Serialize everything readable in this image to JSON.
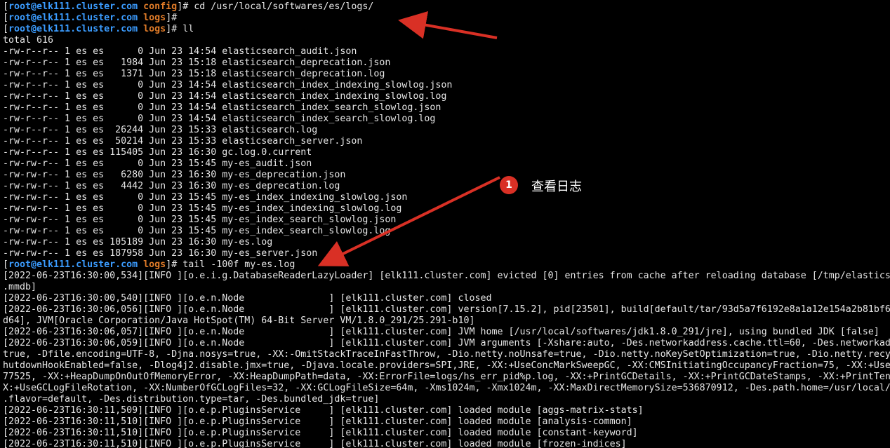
{
  "prompt": {
    "user": "root@elk111.cluster.com"
  },
  "lines": [
    {
      "kind": "prompt",
      "dir": "config",
      "cmd": "cd /usr/local/softwares/es/logs/"
    },
    {
      "kind": "prompt",
      "dir": "logs",
      "cmd": ""
    },
    {
      "kind": "prompt",
      "dir": "logs",
      "cmd": "ll"
    },
    {
      "kind": "out",
      "text": "total 616"
    },
    {
      "kind": "out",
      "text": "-rw-r--r-- 1 es es      0 Jun 23 14:54 elasticsearch_audit.json"
    },
    {
      "kind": "out",
      "text": "-rw-r--r-- 1 es es   1984 Jun 23 15:18 elasticsearch_deprecation.json"
    },
    {
      "kind": "out",
      "text": "-rw-r--r-- 1 es es   1371 Jun 23 15:18 elasticsearch_deprecation.log"
    },
    {
      "kind": "out",
      "text": "-rw-r--r-- 1 es es      0 Jun 23 14:54 elasticsearch_index_indexing_slowlog.json"
    },
    {
      "kind": "out",
      "text": "-rw-r--r-- 1 es es      0 Jun 23 14:54 elasticsearch_index_indexing_slowlog.log"
    },
    {
      "kind": "out",
      "text": "-rw-r--r-- 1 es es      0 Jun 23 14:54 elasticsearch_index_search_slowlog.json"
    },
    {
      "kind": "out",
      "text": "-rw-r--r-- 1 es es      0 Jun 23 14:54 elasticsearch_index_search_slowlog.log"
    },
    {
      "kind": "out",
      "text": "-rw-r--r-- 1 es es  26244 Jun 23 15:33 elasticsearch.log"
    },
    {
      "kind": "out",
      "text": "-rw-r--r-- 1 es es  50214 Jun 23 15:33 elasticsearch_server.json"
    },
    {
      "kind": "out",
      "text": "-rw-r--r-- 1 es es 115405 Jun 23 16:30 gc.log.0.current"
    },
    {
      "kind": "out",
      "text": "-rw-rw-r-- 1 es es      0 Jun 23 15:45 my-es_audit.json"
    },
    {
      "kind": "out",
      "text": "-rw-rw-r-- 1 es es   6280 Jun 23 16:30 my-es_deprecation.json"
    },
    {
      "kind": "out",
      "text": "-rw-rw-r-- 1 es es   4442 Jun 23 16:30 my-es_deprecation.log"
    },
    {
      "kind": "out",
      "text": "-rw-rw-r-- 1 es es      0 Jun 23 15:45 my-es_index_indexing_slowlog.json"
    },
    {
      "kind": "out",
      "text": "-rw-rw-r-- 1 es es      0 Jun 23 15:45 my-es_index_indexing_slowlog.log"
    },
    {
      "kind": "out",
      "text": "-rw-rw-r-- 1 es es      0 Jun 23 15:45 my-es_index_search_slowlog.json"
    },
    {
      "kind": "out",
      "text": "-rw-rw-r-- 1 es es      0 Jun 23 15:45 my-es_index_search_slowlog.log"
    },
    {
      "kind": "out",
      "text": "-rw-rw-r-- 1 es es 105189 Jun 23 16:30 my-es.log"
    },
    {
      "kind": "out",
      "text": "-rw-rw-r-- 1 es es 187958 Jun 23 16:30 my-es_server.json"
    },
    {
      "kind": "prompt",
      "dir": "logs",
      "cmd": "tail -100f my-es.log"
    },
    {
      "kind": "out",
      "text": "[2022-06-23T16:30:00,534][INFO ][o.e.i.g.DatabaseReaderLazyLoader] [elk111.cluster.com] evicted [0] entries from cache after reloading database [/tmp/elastics"
    },
    {
      "kind": "out",
      "text": ".mmdb]"
    },
    {
      "kind": "out",
      "text": "[2022-06-23T16:30:00,540][INFO ][o.e.n.Node               ] [elk111.cluster.com] closed"
    },
    {
      "kind": "out",
      "text": "[2022-06-23T16:30:06,056][INFO ][o.e.n.Node               ] [elk111.cluster.com] version[7.15.2], pid[23501], build[default/tar/93d5a7f6192e8a1a12e154a2b81bf6"
    },
    {
      "kind": "out",
      "text": "d64], JVM[Oracle Corporation/Java HotSpot(TM) 64-Bit Server VM/1.8.0_291/25.291-b10]"
    },
    {
      "kind": "out",
      "text": "[2022-06-23T16:30:06,057][INFO ][o.e.n.Node               ] [elk111.cluster.com] JVM home [/usr/local/softwares/jdk1.8.0_291/jre], using bundled JDK [false]"
    },
    {
      "kind": "out",
      "text": "[2022-06-23T16:30:06,059][INFO ][o.e.n.Node               ] [elk111.cluster.com] JVM arguments [-Xshare:auto, -Des.networkaddress.cache.ttl=60, -Des.networkad"
    },
    {
      "kind": "out",
      "text": "true, -Dfile.encoding=UTF-8, -Djna.nosys=true, -XX:-OmitStackTraceInFastThrow, -Dio.netty.noUnsafe=true, -Dio.netty.noKeySetOptimization=true, -Dio.netty.recy"
    },
    {
      "kind": "out",
      "text": "hutdownHookEnabled=false, -Dlog4j2.disable.jmx=true, -Djava.locale.providers=SPI,JRE, -XX:+UseConcMarkSweepGC, -XX:CMSInitiatingOccupancyFraction=75, -XX:+Use"
    },
    {
      "kind": "out",
      "text": "77525, -XX:+HeapDumpOnOutOfMemoryError, -XX:HeapDumpPath=data, -XX:ErrorFile=logs/hs_err_pid%p.log, -XX:+PrintGCDetails, -XX:+PrintGCDateStamps, -XX:+PrintTen"
    },
    {
      "kind": "out",
      "text": "X:+UseGCLogFileRotation, -XX:NumberOfGCLogFiles=32, -XX:GCLogFileSize=64m, -Xms1024m, -Xmx1024m, -XX:MaxDirectMemorySize=536870912, -Des.path.home=/usr/local/"
    },
    {
      "kind": "out",
      "text": ".flavor=default, -Des.distribution.type=tar, -Des.bundled_jdk=true]"
    },
    {
      "kind": "out",
      "text": "[2022-06-23T16:30:11,509][INFO ][o.e.p.PluginsService     ] [elk111.cluster.com] loaded module [aggs-matrix-stats]"
    },
    {
      "kind": "out",
      "text": "[2022-06-23T16:30:11,510][INFO ][o.e.p.PluginsService     ] [elk111.cluster.com] loaded module [analysis-common]"
    },
    {
      "kind": "out",
      "text": "[2022-06-23T16:30:11,510][INFO ][o.e.p.PluginsService     ] [elk111.cluster.com] loaded module [constant-keyword]"
    },
    {
      "kind": "out",
      "text": "[2022-06-23T16:30:11,510][INFO ][o.e.p.PluginsService     ] [elk111.cluster.com] loaded module [frozen-indices]"
    }
  ],
  "annotation": {
    "number": "1",
    "text": "查看日志"
  },
  "colors": {
    "user": "#3b9cff",
    "dir": "#e07b28",
    "arrow": "#d93025"
  }
}
